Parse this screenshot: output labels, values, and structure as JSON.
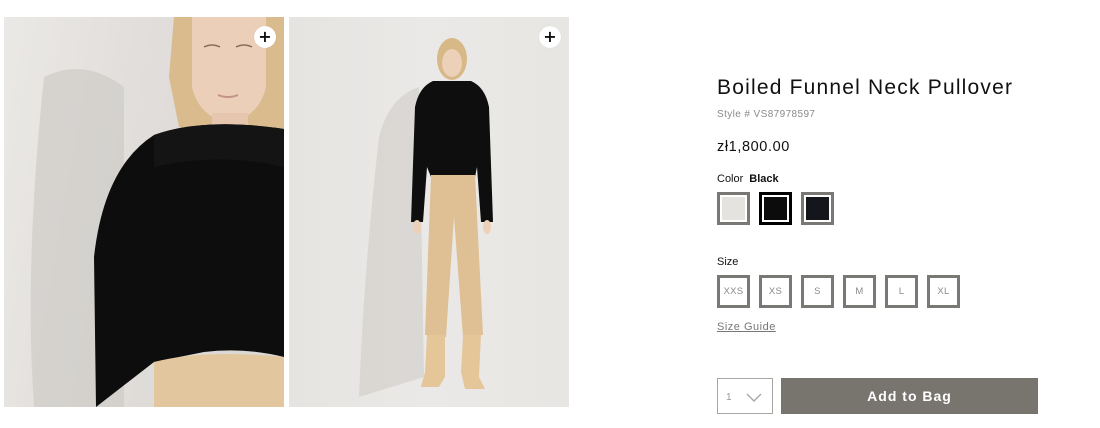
{
  "gallery": {
    "images": [
      {
        "alt": "close-up of model wearing black pullover",
        "zoom_label": "+"
      },
      {
        "alt": "full-length model wearing black pullover and tan trousers",
        "zoom_label": "+"
      }
    ]
  },
  "product": {
    "title": "Boiled Funnel Neck Pullover",
    "style_number": "Style # VS87978597",
    "price": "zł1,800.00",
    "color": {
      "label": "Color",
      "selected": "Black",
      "swatches": [
        {
          "name": "light-swatch",
          "hex": "#e4e3df",
          "selected": false
        },
        {
          "name": "black-swatch",
          "hex": "#0c0c0c",
          "selected": true
        },
        {
          "name": "navy-swatch",
          "hex": "#14161c",
          "selected": false
        }
      ]
    },
    "size": {
      "label": "Size",
      "options": [
        "XXS",
        "XS",
        "S",
        "M",
        "L",
        "XL"
      ],
      "guide_link": "Size Guide"
    },
    "quantity": "1",
    "add_to_bag_label": "Add to Bag"
  },
  "colors": {
    "button_bg": "#78756f",
    "border_gray": "#7a7874"
  }
}
